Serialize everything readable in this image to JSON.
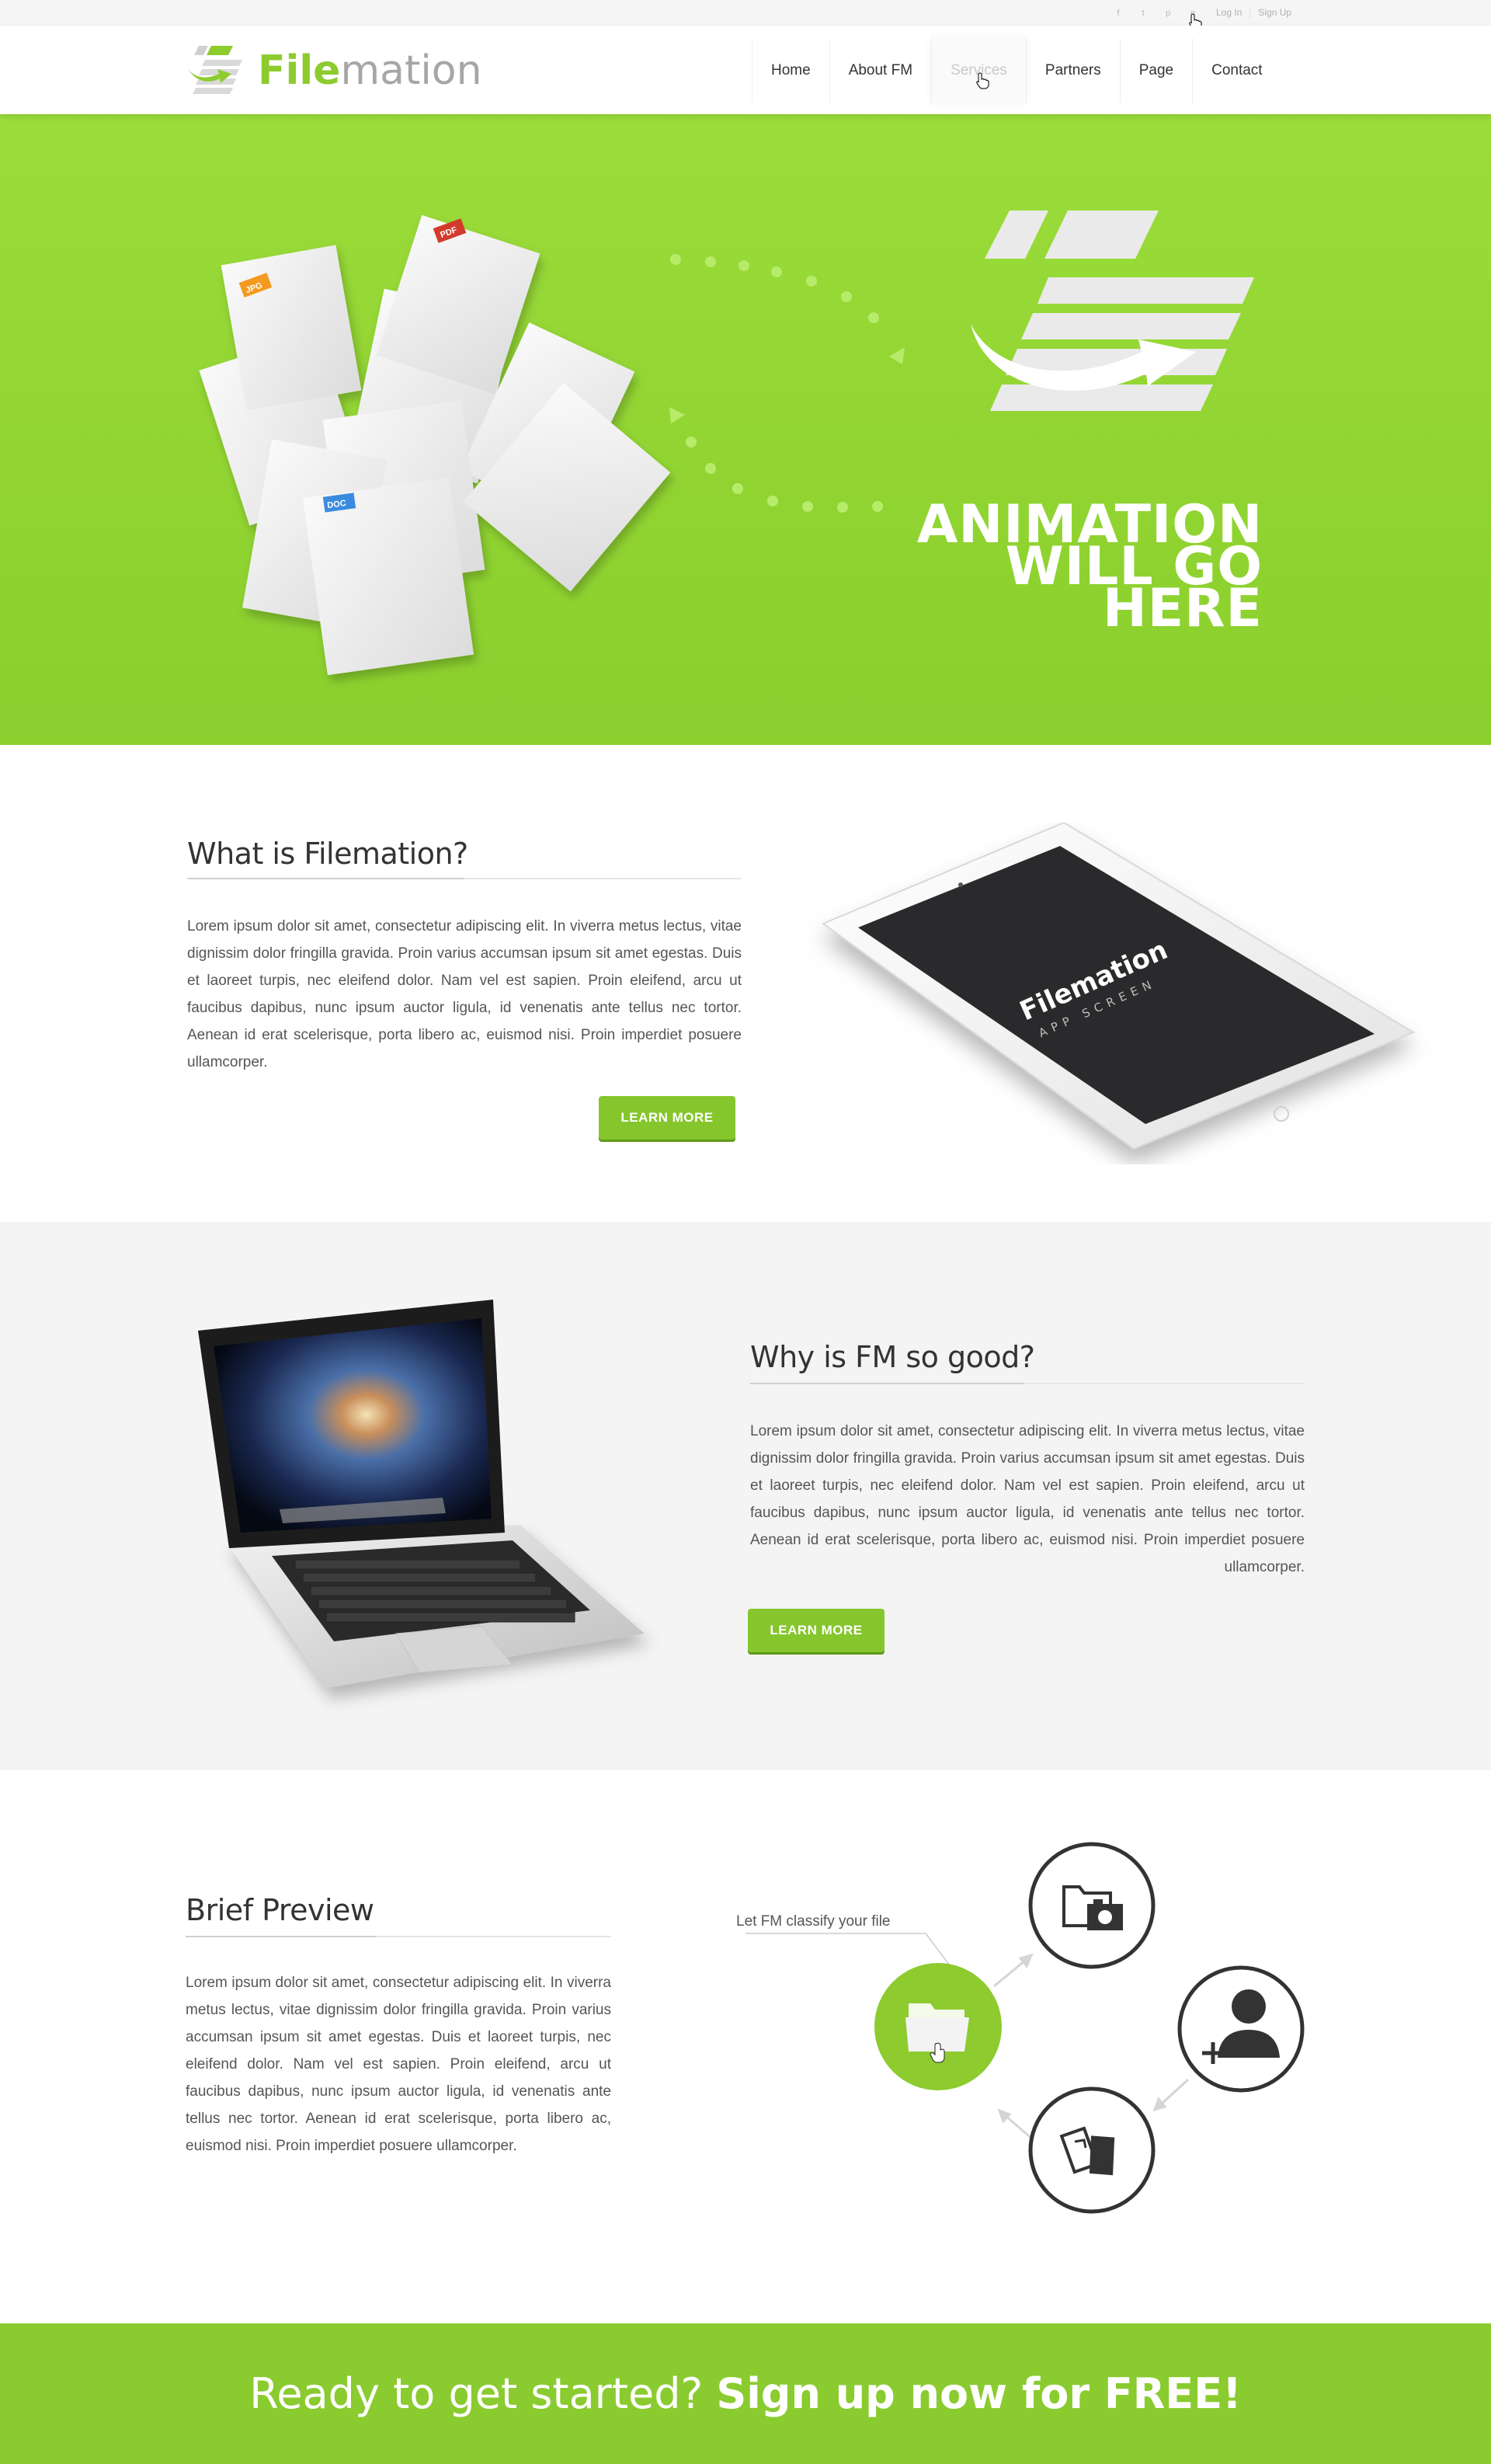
{
  "topbar": {
    "social_icons": [
      "facebook-icon",
      "twitter-icon",
      "pinterest-icon",
      "google-plus-icon"
    ],
    "social_glyphs": [
      "f",
      "t",
      "p",
      "g"
    ],
    "login_label": "Log In",
    "signup_label": "Sign Up"
  },
  "header": {
    "logo_text_a": "File",
    "logo_text_b": "mation",
    "nav": [
      {
        "label": "Home"
      },
      {
        "label": "About FM"
      },
      {
        "label": "Services",
        "active": true
      },
      {
        "label": "Partners"
      },
      {
        "label": "Page"
      },
      {
        "label": "Contact"
      }
    ]
  },
  "hero": {
    "headline_line1": "ANIMATION",
    "headline_line2": "WILL GO",
    "headline_line3": "HERE",
    "doc_badges": [
      "JPG",
      "PDF",
      "DOC"
    ],
    "badge_colors": {
      "JPG": "#f39a1f",
      "PDF": "#d23b2b",
      "DOC": "#3b8be0"
    }
  },
  "section_what": {
    "title": "What is Filemation?",
    "body": "Lorem ipsum dolor sit amet, consectetur adipiscing elit. In viverra metus lectus, vitae dignissim dolor fringilla gravida. Proin varius accumsan ipsum sit amet egestas. Duis et laoreet turpis, nec eleifend dolor. Nam vel est sapien. Proin eleifend, arcu ut faucibus dapibus, nunc ipsum auctor ligula, id venenatis ante tellus nec tortor. Aenean id erat scelerisque, porta libero ac, euismod nisi. Proin imperdiet posuere ullamcorper.",
    "button_label": "LEARN MORE",
    "tablet_screen_title": "Filemation",
    "tablet_screen_subtitle": "APP SCREEN"
  },
  "section_why": {
    "title": "Why is FM so good?",
    "body": "Lorem ipsum dolor sit amet, consectetur adipiscing elit. In viverra metus lectus, vitae dignissim dolor fringilla gravida. Proin varius accumsan ipsum sit amet egestas. Duis et laoreet turpis, nec eleifend dolor. Nam vel est sapien. Proin eleifend, arcu ut faucibus dapibus, nunc ipsum auctor ligula, id venenatis ante tellus nec tortor. Aenean id erat scelerisque, porta libero ac, euismod nisi. Proin imperdiet posuere ullamcorper.",
    "button_label": "LEARN MORE"
  },
  "section_preview": {
    "title": "Brief Preview",
    "body": "Lorem ipsum dolor sit amet, consectetur adipiscing elit. In viverra metus lectus, vitae dignissim dolor fringilla gravida. Proin varius accumsan ipsum sit amet egestas. Duis et laoreet turpis, nec eleifend dolor. Nam vel est sapien. Proin eleifend, arcu ut faucibus dapibus, nunc ipsum auctor ligula, id venenatis ante tellus nec tortor. Aenean id erat scelerisque, porta libero ac, euismod nisi. Proin imperdiet posuere ullamcorper.",
    "callout_label": "Let FM classify your file"
  },
  "cta": {
    "text_regular": "Ready to get started? ",
    "text_strong": "Sign up now for FREE!"
  },
  "colors": {
    "brand_green": "#8dcb2f",
    "hero_green": "#93d633",
    "button_green": "#86c62d",
    "section_gray": "#f4f4f4",
    "text_dark": "#333333"
  }
}
